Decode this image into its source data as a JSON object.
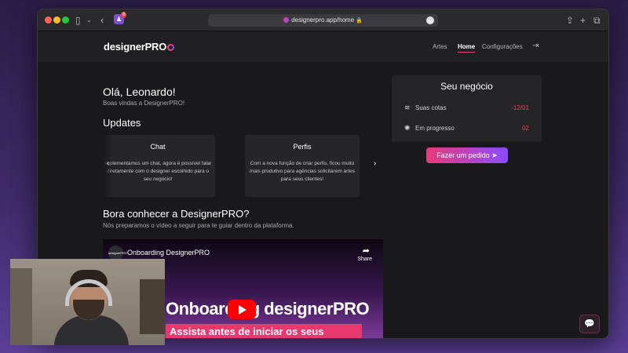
{
  "browser": {
    "url": "designerpro.app/home",
    "extension_badge_count": "8",
    "icons": [
      "sidebar-icon",
      "chevron-down-icon",
      "back-icon",
      "lock-icon",
      "more-icon",
      "share-icon",
      "new-tab-icon",
      "tabs-icon"
    ]
  },
  "navbar": {
    "logo_text": "designerPRO",
    "links": [
      "Artes",
      "Home",
      "Configurações"
    ],
    "active_link": "Home"
  },
  "greeting": {
    "title": "Olá, Leonardo!",
    "subtitle": "Boas vindas a DesignerPRO!"
  },
  "updates": {
    "title": "Updates",
    "cards": [
      {
        "title": "Chat",
        "text": "Implementamos um chat, agora é possível falar diretamente com o designer escolhido para o seu negócio!"
      },
      {
        "title": "Perfis",
        "text": "Com a nova função de criar perfis, ficou muito mais produtivo para agências solicitarem artes para seus clientes!"
      }
    ]
  },
  "onboarding": {
    "title": "Bora conhecer a DesignerPRO?",
    "description": "Nós preparamos o vídeo a seguir para te guiar dentro da plataforma.",
    "video": {
      "channel_avatar_text": "designerPRO",
      "title": "Onboarding DesignerPRO",
      "share_label": "Share",
      "headline": "Onboarding designerPRO",
      "banner": "Assista antes de iniciar os seus pedidos!"
    }
  },
  "business_panel": {
    "title": "Seu negócio",
    "rows": [
      {
        "icon": "layers-icon",
        "label": "Suas cotas",
        "value": "-12/01"
      },
      {
        "icon": "loading-icon",
        "label": "Em progresso",
        "value": "02"
      }
    ],
    "order_button": "Fazer um pedido"
  },
  "colors": {
    "accent_pink": "#ee3c7f",
    "accent_purple": "#8a4bff",
    "value_red": "#ee3c5c"
  }
}
